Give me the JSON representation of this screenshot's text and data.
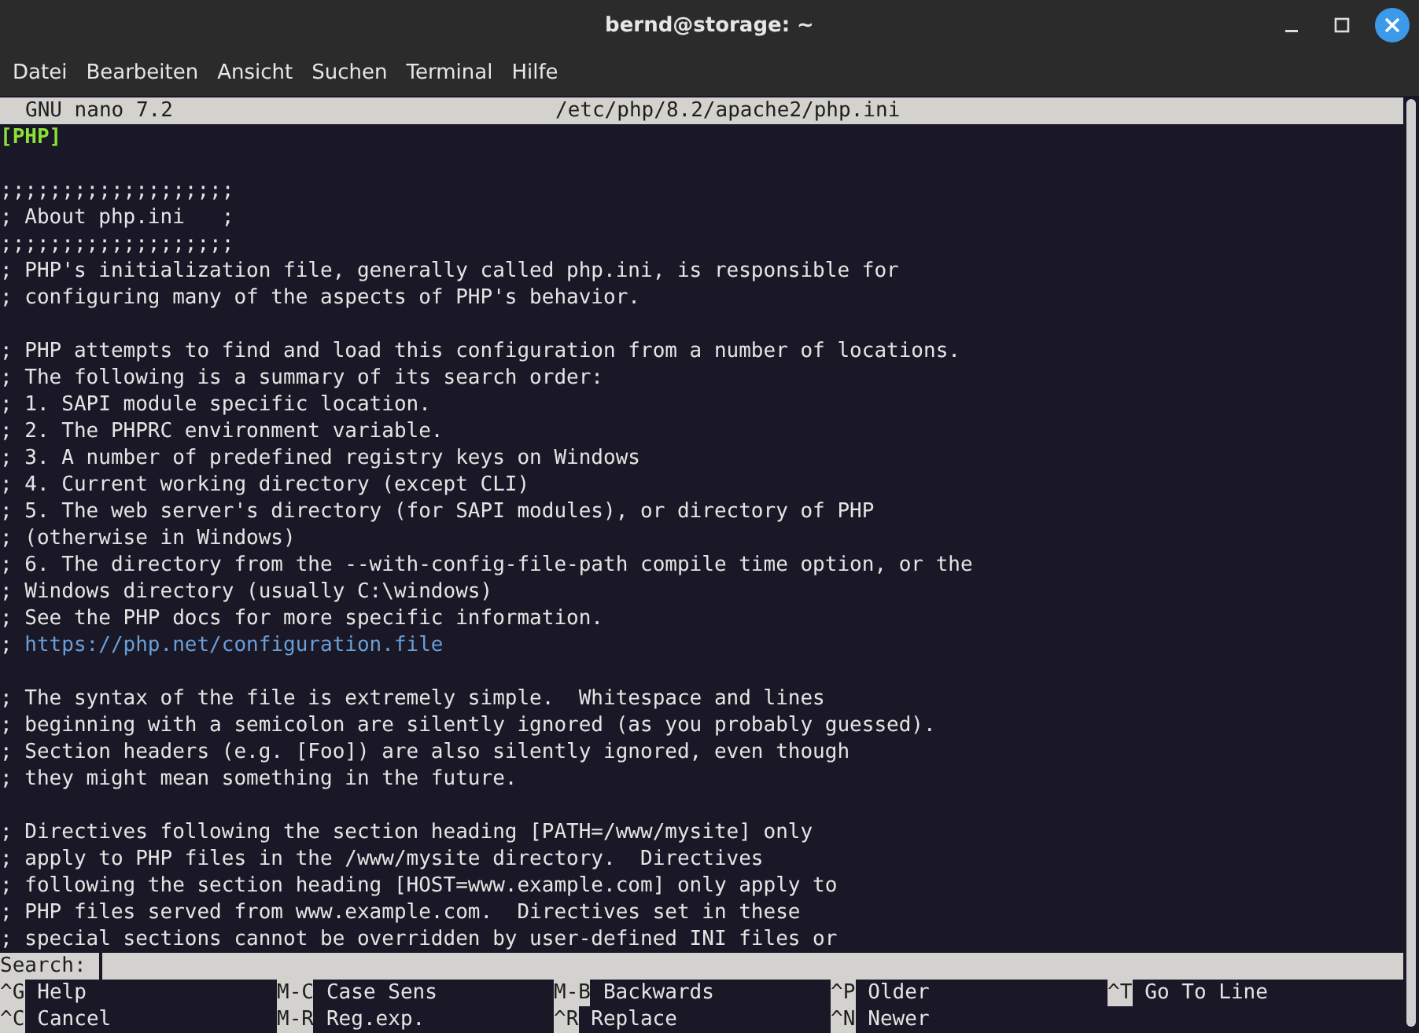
{
  "window": {
    "title": "bernd@storage: ~"
  },
  "menu": [
    "Datei",
    "Bearbeiten",
    "Ansicht",
    "Suchen",
    "Terminal",
    "Hilfe"
  ],
  "nano_header": {
    "version": "GNU nano 7.2",
    "filename": "/etc/php/8.2/apache2/php.ini"
  },
  "lines": [
    {
      "kind": "section",
      "text": "[PHP]"
    },
    {
      "kind": "blank"
    },
    {
      "kind": "comment",
      "text": ";;;;;;;;;;;;;;;;;;;"
    },
    {
      "kind": "comment",
      "text": "; About php.ini   ;"
    },
    {
      "kind": "comment",
      "text": ";;;;;;;;;;;;;;;;;;;"
    },
    {
      "kind": "comment",
      "text": "; PHP's initialization file, generally called php.ini, is responsible for"
    },
    {
      "kind": "comment",
      "text": "; configuring many of the aspects of PHP's behavior."
    },
    {
      "kind": "blank"
    },
    {
      "kind": "comment",
      "text": "; PHP attempts to find and load this configuration from a number of locations."
    },
    {
      "kind": "comment",
      "text": "; The following is a summary of its search order:"
    },
    {
      "kind": "comment",
      "text": "; 1. SAPI module specific location."
    },
    {
      "kind": "comment",
      "text": "; 2. The PHPRC environment variable."
    },
    {
      "kind": "comment",
      "text": "; 3. A number of predefined registry keys on Windows"
    },
    {
      "kind": "comment",
      "text": "; 4. Current working directory (except CLI)"
    },
    {
      "kind": "comment",
      "text": "; 5. The web server's directory (for SAPI modules), or directory of PHP"
    },
    {
      "kind": "comment",
      "text": "; (otherwise in Windows)"
    },
    {
      "kind": "comment",
      "text": "; 6. The directory from the --with-config-file-path compile time option, or the"
    },
    {
      "kind": "comment",
      "text": "; Windows directory (usually C:\\windows)"
    },
    {
      "kind": "comment",
      "text": "; See the PHP docs for more specific information."
    },
    {
      "kind": "link",
      "text": ";",
      "link": "https://php.net/configuration.file"
    },
    {
      "kind": "blank"
    },
    {
      "kind": "comment",
      "text": "; The syntax of the file is extremely simple.  Whitespace and lines"
    },
    {
      "kind": "comment",
      "text": "; beginning with a semicolon are silently ignored (as you probably guessed)."
    },
    {
      "kind": "comment",
      "text": "; Section headers (e.g. [Foo]) are also silently ignored, even though"
    },
    {
      "kind": "comment",
      "text": "; they might mean something in the future."
    },
    {
      "kind": "blank"
    },
    {
      "kind": "comment",
      "text": "; Directives following the section heading [PATH=/www/mysite] only"
    },
    {
      "kind": "comment",
      "text": "; apply to PHP files in the /www/mysite directory.  Directives"
    },
    {
      "kind": "comment",
      "text": "; following the section heading [HOST=www.example.com] only apply to"
    },
    {
      "kind": "comment",
      "text": "; PHP files served from www.example.com.  Directives set in these"
    },
    {
      "kind": "comment",
      "text": "; special sections cannot be overridden by user-defined INI files or"
    }
  ],
  "prompt": {
    "label": "Search:"
  },
  "shortcuts": [
    [
      {
        "key": "^G",
        "label": "Help"
      },
      {
        "key": "M-C",
        "label": "Case Sens"
      },
      {
        "key": "M-B",
        "label": "Backwards"
      },
      {
        "key": "^P",
        "label": "Older"
      },
      {
        "key": "^T",
        "label": "Go To Line"
      }
    ],
    [
      {
        "key": "^C",
        "label": "Cancel"
      },
      {
        "key": "M-R",
        "label": "Reg.exp."
      },
      {
        "key": "^R",
        "label": "Replace"
      },
      {
        "key": "^N",
        "label": "Newer"
      }
    ]
  ]
}
